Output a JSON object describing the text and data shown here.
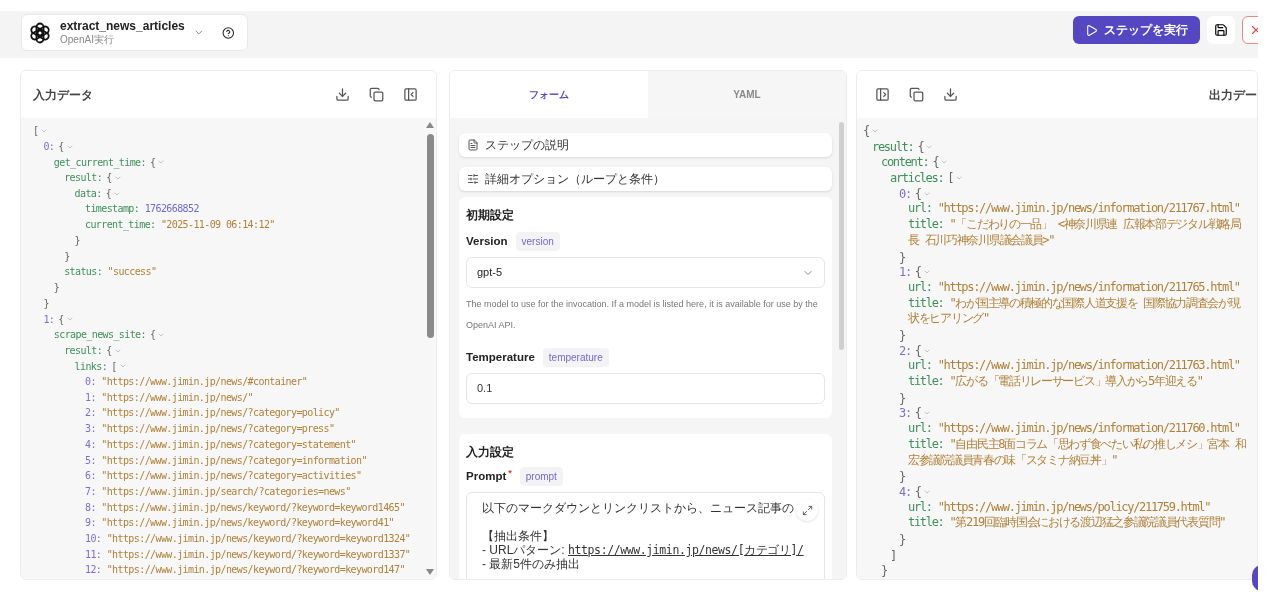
{
  "header": {
    "title": "extract_news_articles",
    "subtitle": "OpenAI実行",
    "run_button": "ステップを実行"
  },
  "input_panel": {
    "title": "入力データ",
    "tree": {
      "kind": "array",
      "open": "[",
      "expanded": true,
      "children": [
        {
          "key": "0:",
          "kind": "object",
          "open": "{",
          "expanded": true,
          "close": "}",
          "children": [
            {
              "key": "get_current_time:",
              "kind": "object",
              "open": "{",
              "expanded": true,
              "close": "}",
              "children": [
                {
                  "key": "result:",
                  "kind": "object",
                  "open": "{",
                  "expanded": true,
                  "close": "}",
                  "children": [
                    {
                      "key": "data:",
                      "kind": "object",
                      "open": "{",
                      "expanded": true,
                      "close": "}",
                      "children": [
                        {
                          "key": "timestamp:",
                          "kind": "number",
                          "value": "1762668852"
                        },
                        {
                          "key": "current_time:",
                          "kind": "string",
                          "value": "\"2025-11-09 06:14:12\""
                        }
                      ]
                    }
                  ]
                },
                {
                  "key": "status:",
                  "kind": "string",
                  "value": "\"success\""
                }
              ]
            }
          ]
        },
        {
          "key": "1:",
          "kind": "object",
          "open": "{",
          "expanded": true,
          "children": [
            {
              "key": "scrape_news_site:",
              "kind": "object",
              "open": "{",
              "expanded": true,
              "children": [
                {
                  "key": "result:",
                  "kind": "object",
                  "open": "{",
                  "expanded": true,
                  "children": [
                    {
                      "key": "links:",
                      "kind": "array",
                      "open": "[",
                      "expanded": true,
                      "children": [
                        {
                          "key": "0:",
                          "kind": "string",
                          "value": "\"https://www.jimin.jp/news/#container\""
                        },
                        {
                          "key": "1:",
                          "kind": "string",
                          "value": "\"https://www.jimin.jp/news/\""
                        },
                        {
                          "key": "2:",
                          "kind": "string",
                          "value": "\"https://www.jimin.jp/news/?category=policy\""
                        },
                        {
                          "key": "3:",
                          "kind": "string",
                          "value": "\"https://www.jimin.jp/news/?category=press\""
                        },
                        {
                          "key": "4:",
                          "kind": "string",
                          "value": "\"https://www.jimin.jp/news/?category=statement\""
                        },
                        {
                          "key": "5:",
                          "kind": "string",
                          "value": "\"https://www.jimin.jp/news/?category=information\""
                        },
                        {
                          "key": "6:",
                          "kind": "string",
                          "value": "\"https://www.jimin.jp/news/?category=activities\""
                        },
                        {
                          "key": "7:",
                          "kind": "string",
                          "value": "\"https://www.jimin.jp/search/?categories=news\""
                        },
                        {
                          "key": "8:",
                          "kind": "string",
                          "value": "\"https://www.jimin.jp/news/keyword/?keyword=keyword1465\""
                        },
                        {
                          "key": "9:",
                          "kind": "string",
                          "value": "\"https://www.jimin.jp/news/keyword/?keyword=keyword41\""
                        },
                        {
                          "key": "10:",
                          "kind": "string",
                          "value": "\"https://www.jimin.jp/news/keyword/?keyword=keyword1324\""
                        },
                        {
                          "key": "11:",
                          "kind": "string",
                          "value": "\"https://www.jimin.jp/news/keyword/?keyword=keyword1337\""
                        },
                        {
                          "key": "12:",
                          "kind": "string",
                          "value": "\"https://www.jimin.jp/news/keyword/?keyword=keyword147\""
                        }
                      ]
                    }
                  ]
                }
              ]
            }
          ]
        }
      ]
    }
  },
  "form_panel": {
    "tabs": [
      {
        "label": "フォーム",
        "selected": true
      },
      {
        "label": "YAML",
        "selected": false
      }
    ],
    "sections": [
      {
        "label": "ステップの説明",
        "kind": "description"
      },
      {
        "label": "詳細オプション（ループと条件）",
        "kind": "options"
      }
    ],
    "initial_settings": {
      "heading": "初期設定",
      "version": {
        "label": "Version",
        "badge": "version",
        "value": "gpt-5",
        "help": "The model to use for the invocation. If a model is listed here, it is available for use by the OpenAI API."
      },
      "temperature": {
        "label": "Temperature",
        "badge": "temperature",
        "value": "0.1"
      }
    },
    "input_settings": {
      "heading": "入力設定",
      "prompt": {
        "label": "Prompt",
        "required_mark": "*",
        "badge": "prompt",
        "lines": [
          {
            "kind": "text",
            "text": "以下のマークダウンとリンクリストから、ニュース記事の"
          },
          {
            "kind": "blank"
          },
          {
            "kind": "text",
            "text": "【抽出条件】"
          },
          {
            "kind": "text",
            "text": "- URLパターン: ",
            "link": "https://www.jimin.jp/news/[カテゴリ]/"
          },
          {
            "kind": "text",
            "text": "- 最新5件のみ抽出"
          }
        ]
      }
    }
  },
  "output_panel": {
    "title": "出力デー",
    "tree": {
      "kind": "object",
      "open": "{",
      "expanded": true,
      "children": [
        {
          "key": "result:",
          "kind": "object",
          "open": "{",
          "expanded": true,
          "children": [
            {
              "key": "content:",
              "kind": "object",
              "open": "{",
              "expanded": true,
              "close": "}",
              "children": [
                {
                  "key": "articles:",
                  "kind": "array",
                  "open": "[",
                  "expanded": true,
                  "close": "]",
                  "children": [
                    {
                      "key": "0:",
                      "kind": "object",
                      "open": "{",
                      "expanded": true,
                      "close": "}",
                      "children": [
                        {
                          "key": "url:",
                          "kind": "string",
                          "value": "\"https://www.jimin.jp/news/information/211767.html\""
                        },
                        {
                          "key": "title:",
                          "kind": "string",
                          "value": "\"「こだわりの一品」 <神奈川県連 広報本部デジタル戦略局長 石川巧神奈川県議会議員>\""
                        }
                      ]
                    },
                    {
                      "key": "1:",
                      "kind": "object",
                      "open": "{",
                      "expanded": true,
                      "close": "}",
                      "children": [
                        {
                          "key": "url:",
                          "kind": "string",
                          "value": "\"https://www.jimin.jp/news/information/211765.html\""
                        },
                        {
                          "key": "title:",
                          "kind": "string",
                          "value": "\"わが国主導の積極的な国際人道支援を 国際協力調査会が現状をヒアリング\""
                        }
                      ]
                    },
                    {
                      "key": "2:",
                      "kind": "object",
                      "open": "{",
                      "expanded": true,
                      "close": "}",
                      "children": [
                        {
                          "key": "url:",
                          "kind": "string",
                          "value": "\"https://www.jimin.jp/news/information/211763.html\""
                        },
                        {
                          "key": "title:",
                          "kind": "string",
                          "value": "\"広がる「電話リレーサービス」導入から5年迎える\""
                        }
                      ]
                    },
                    {
                      "key": "3:",
                      "kind": "object",
                      "open": "{",
                      "expanded": true,
                      "close": "}",
                      "children": [
                        {
                          "key": "url:",
                          "kind": "string",
                          "value": "\"https://www.jimin.jp/news/information/211760.html\""
                        },
                        {
                          "key": "title:",
                          "kind": "string",
                          "value": "\"自由民主8面コラム「思わず食べたい私の推しメシ」宮本 和宏参議院議員青春の味「スタミナ納豆丼」\""
                        }
                      ]
                    },
                    {
                      "key": "4:",
                      "kind": "object",
                      "open": "{",
                      "expanded": true,
                      "close": "}",
                      "children": [
                        {
                          "key": "url:",
                          "kind": "string",
                          "value": "\"https://www.jimin.jp/news/policy/211759.html\""
                        },
                        {
                          "key": "title:",
                          "kind": "string",
                          "value": "\"第219回臨時国会における渡辺猛之参議院議員代表質問\""
                        }
                      ]
                    }
                  ]
                }
              ]
            }
          ]
        }
      ]
    }
  }
}
